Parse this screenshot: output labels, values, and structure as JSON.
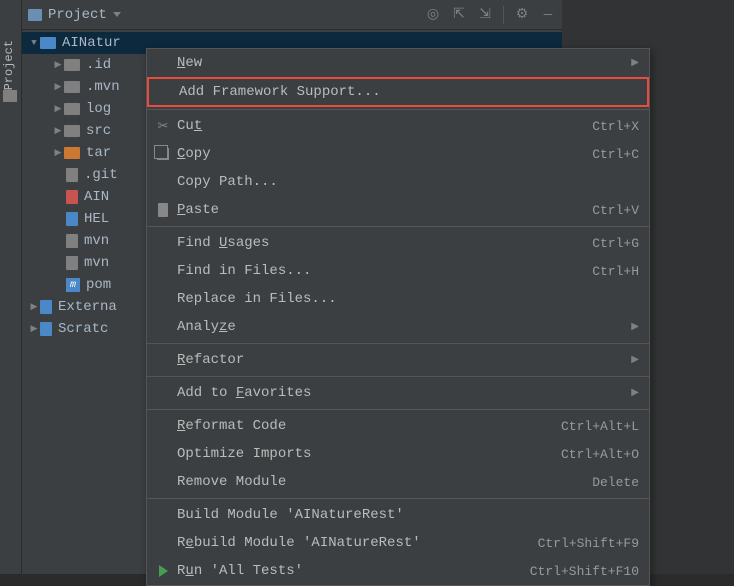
{
  "toolbar": {
    "title": "Project"
  },
  "tree": {
    "root": "AINatur",
    "items": [
      ".id",
      ".mvn",
      "log",
      "src",
      "tar",
      ".git",
      "AIN",
      "HEL",
      "mvn",
      "mvn",
      "pom"
    ],
    "externa": "Externa",
    "scratch": "Scratc"
  },
  "menu": {
    "new": "New",
    "addFramework": "Add Framework Support...",
    "cut": {
      "label": "Cut",
      "u": "t",
      "shortcut": "Ctrl+X"
    },
    "copy": {
      "label": "Copy",
      "u": "C",
      "shortcut": "Ctrl+C"
    },
    "copyPath": {
      "label": "Copy Path..."
    },
    "paste": {
      "label": "Paste",
      "u": "P",
      "shortcut": "Ctrl+V"
    },
    "findUsages": {
      "label": "Find Usages",
      "u": "U",
      "shortcut": "Ctrl+G"
    },
    "findInFiles": {
      "label": "Find in Files...",
      "shortcut": "Ctrl+H"
    },
    "replaceInFiles": {
      "label": "Replace in Files..."
    },
    "analyze": {
      "label": "Analyze",
      "u": "z"
    },
    "refactor": {
      "label": "Refactor",
      "u": "R"
    },
    "addToFav": {
      "label": "Add to Favorites",
      "u": "F"
    },
    "reformat": {
      "label": "Reformat Code",
      "u": "R",
      "shortcut": "Ctrl+Alt+L"
    },
    "optimize": {
      "label": "Optimize Imports",
      "shortcut": "Ctrl+Alt+O"
    },
    "removeModule": {
      "label": "Remove Module",
      "shortcut": "Delete"
    },
    "buildModule": {
      "label": "Build Module 'AINatureRest'"
    },
    "rebuildModule": {
      "label": "Rebuild Module 'AINatureRest'",
      "u": "e",
      "shortcut": "Ctrl+Shift+F9"
    },
    "runAll": {
      "label": "Run 'All Tests'",
      "u": "u",
      "shortcut": "Ctrl+Shift+F10"
    }
  }
}
